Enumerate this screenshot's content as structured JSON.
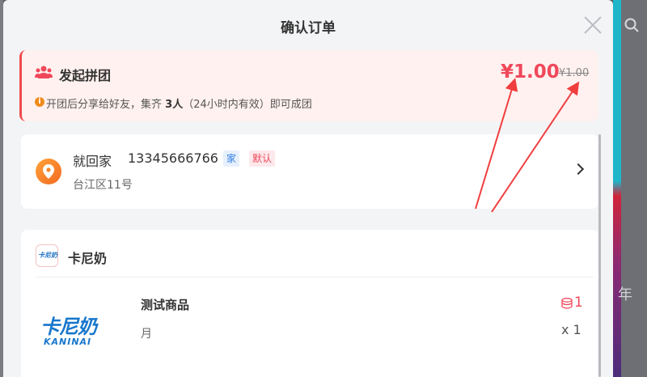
{
  "modal": {
    "title": "确认订单"
  },
  "group": {
    "title": "发起拼团",
    "price": "¥1.00",
    "original_price": "¥1.00",
    "info_prefix": "开团后分享给好友，集齐",
    "info_count": "3人",
    "info_suffix": "（24小时内有效）即可成团"
  },
  "address": {
    "name": "就回家",
    "phone": "13345666766",
    "tag_home": "家",
    "tag_default": "默认",
    "detail": "台江区11号"
  },
  "shop": {
    "name": "卡尼奶",
    "logo_text": "卡尼奶",
    "product": {
      "logo_main": "卡尼奶",
      "logo_sub": "KANINAI",
      "name": "测试商品",
      "spec": "月",
      "points": "1",
      "quantity": "x 1"
    }
  },
  "background": {
    "side_text": "年"
  },
  "colors": {
    "accent": "#f0485b",
    "info": "#f18b1a",
    "location": "#f26a21",
    "brand_blue": "#1877cc"
  }
}
